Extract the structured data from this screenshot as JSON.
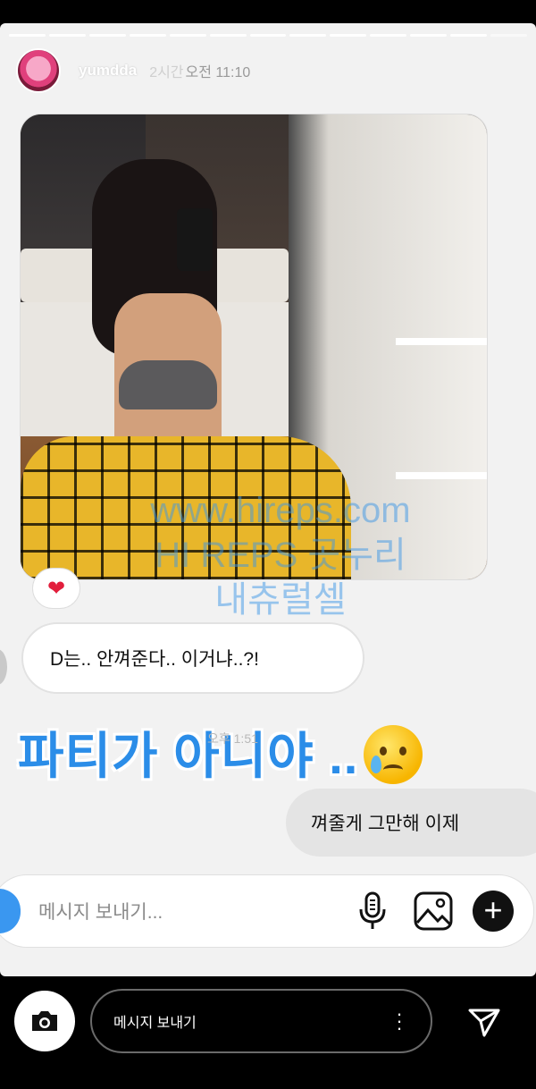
{
  "story": {
    "username": "yumdda",
    "time_ago": "2시간",
    "clock": "오전 11:10",
    "progress_segments": 13,
    "progress_active": 12
  },
  "messages": {
    "reaction_emoji": "❤",
    "incoming_text": "D는.. 안껴준다.. 이거냐..?!",
    "sticker_text": "파티가 아니야 ..",
    "sticker_emoji": "crying-face-emoji",
    "message_time": "오후 1:51",
    "outgoing_text": "껴줄게 그만해 이제"
  },
  "composer": {
    "placeholder": "메시지 보내기..."
  },
  "bottom_bar": {
    "reply_placeholder": "메시지 보내기"
  },
  "watermark": {
    "line1": "www.hireps.com",
    "line2": "HI REPS 곳누리",
    "line3": "내츄럴셀"
  },
  "colors": {
    "story_bg": "#f2f2f2",
    "sticker_blue": "#2b8de8",
    "heart_red": "#e21e3c",
    "accent_blue": "#3a97f0"
  }
}
